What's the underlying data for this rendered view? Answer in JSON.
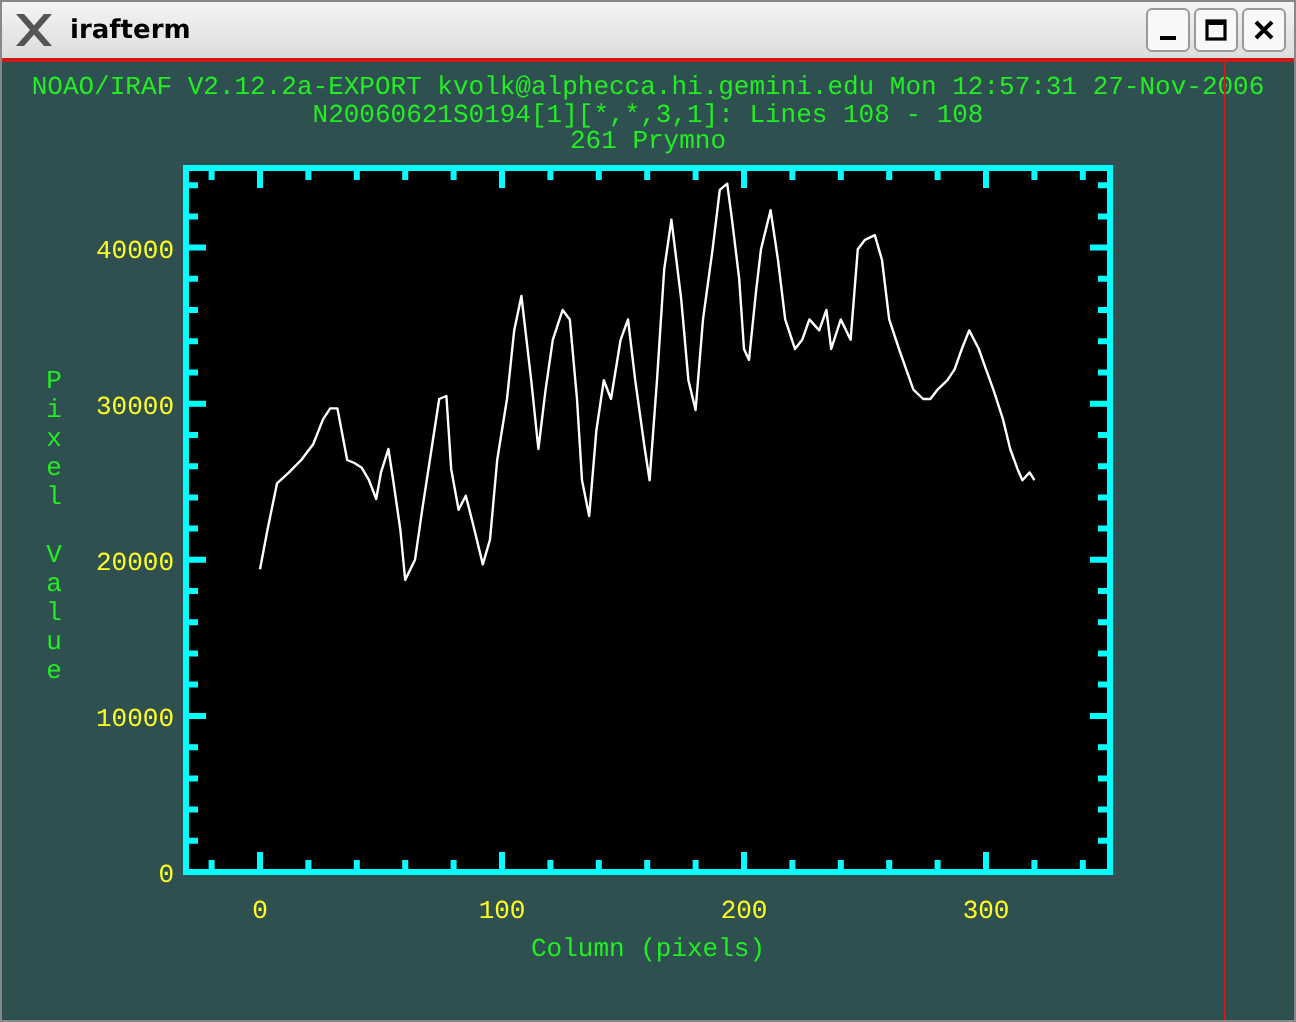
{
  "window": {
    "title": "irafterm"
  },
  "header": [
    "NOAO/IRAF V2.12.2a-EXPORT kvolk@alphecca.hi.gemini.edu Mon 12:57:31 27-Nov-2006",
    "N20060621S0194[1][*,*,3,1]: Lines 108 - 108",
    "261 Prymno"
  ],
  "chart_data": {
    "type": "line",
    "xlabel": "Column (pixels)",
    "ylabel": "Pixel Value",
    "xlim": [
      -30.6,
      351.2
    ],
    "ylim": [
      0,
      45100
    ],
    "xticks": [
      0,
      100,
      200,
      300
    ],
    "yticks": [
      0,
      10000,
      20000,
      30000,
      40000
    ],
    "x": [
      0,
      3,
      7,
      12,
      17,
      22,
      26,
      29,
      32,
      36,
      39,
      42,
      45,
      48,
      50,
      53,
      55,
      58,
      60,
      64,
      67,
      70,
      74,
      77,
      79,
      82,
      85,
      88,
      92,
      95,
      98,
      102,
      105,
      108,
      112,
      115,
      118,
      121,
      125,
      128,
      131,
      133,
      136,
      139,
      142,
      145,
      149,
      152,
      155,
      159,
      161,
      164,
      167,
      170,
      174,
      177,
      180,
      183,
      187,
      190,
      193,
      195,
      198,
      200,
      202,
      205,
      207,
      211,
      214,
      217,
      221,
      224,
      227,
      231,
      234,
      236,
      240,
      244,
      247,
      250,
      254,
      257,
      260,
      264,
      267,
      270,
      274,
      277,
      280,
      284,
      287,
      290,
      293,
      297,
      300,
      303,
      307,
      310,
      313,
      315,
      318,
      320
    ],
    "series": [
      {
        "color": "#ffffff",
        "values": [
          19400,
          21900,
          24900,
          25600,
          26400,
          27400,
          29000,
          29700,
          29700,
          26400,
          26200,
          25900,
          25100,
          23900,
          25600,
          27100,
          25100,
          21900,
          18700,
          20000,
          23200,
          26200,
          30300,
          30500,
          25800,
          23200,
          24100,
          22300,
          19700,
          21300,
          26400,
          30300,
          34700,
          36900,
          31500,
          27100,
          30900,
          34100,
          36000,
          35400,
          30300,
          25100,
          22800,
          28300,
          31500,
          30300,
          34100,
          35400,
          31500,
          27100,
          25100,
          31500,
          38600,
          41800,
          36700,
          31500,
          29600,
          35400,
          39900,
          43700,
          44100,
          41800,
          38000,
          33500,
          32800,
          37300,
          39900,
          42400,
          39200,
          35400,
          33500,
          34100,
          35400,
          34700,
          36000,
          33500,
          35400,
          34100,
          39900,
          40500,
          40800,
          39200,
          35400,
          33500,
          32200,
          30900,
          30300,
          30300,
          30900,
          31500,
          32200,
          33500,
          34700,
          33500,
          32200,
          30900,
          29000,
          27100,
          25800,
          25100,
          25600,
          25100
        ]
      }
    ]
  }
}
